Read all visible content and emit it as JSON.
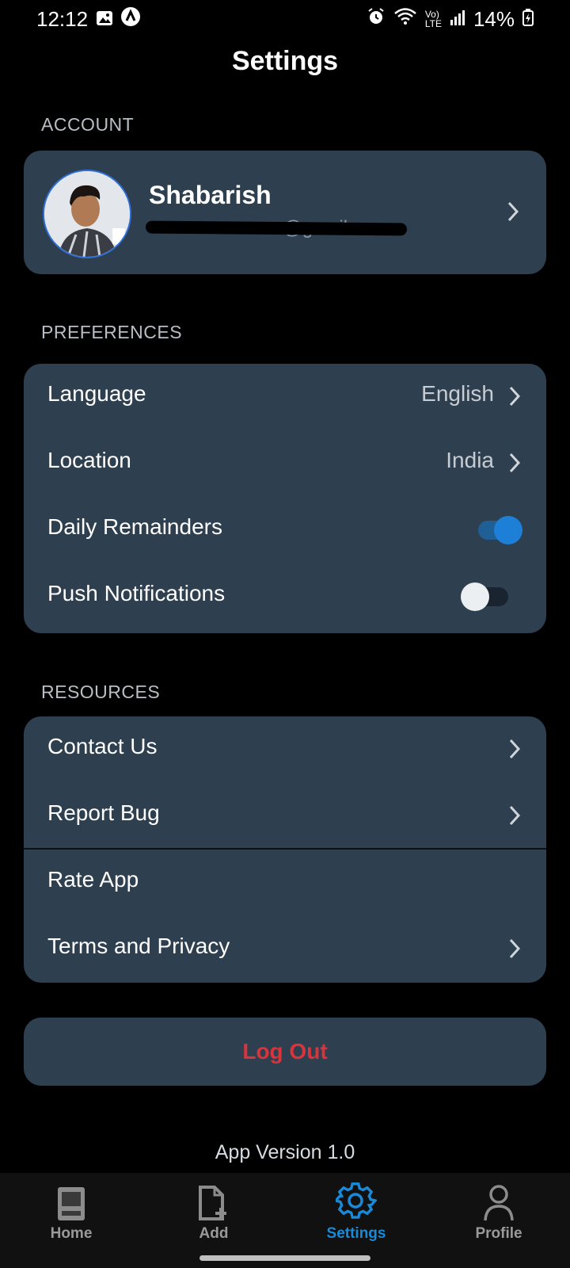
{
  "status": {
    "time": "12:12",
    "battery": "14%"
  },
  "header": {
    "title": "Settings"
  },
  "account": {
    "section_label": "ACCOUNT",
    "name": "Shabarish",
    "email_visible_part": "a@gmail.com"
  },
  "preferences": {
    "section_label": "PREFERENCES",
    "language": {
      "label": "Language",
      "value": "English"
    },
    "location": {
      "label": "Location",
      "value": "India"
    },
    "daily_reminders": {
      "label": "Daily Remainders",
      "on": true
    },
    "push_notifications": {
      "label": "Push Notifications",
      "on": false
    }
  },
  "resources": {
    "section_label": "RESOURCES",
    "items": [
      "Contact Us",
      "Report Bug",
      "Rate App",
      "Terms and Privacy"
    ]
  },
  "logout_label": "Log Out",
  "app_version": "App Version 1.0",
  "nav": {
    "items": [
      {
        "label": "Home",
        "icon": "book-icon",
        "active": false
      },
      {
        "label": "Add",
        "icon": "add-file-icon",
        "active": false
      },
      {
        "label": "Settings",
        "icon": "gear-icon",
        "active": true
      },
      {
        "label": "Profile",
        "icon": "person-icon",
        "active": false
      }
    ]
  },
  "colors": {
    "accent": "#1e88e5",
    "card": "#2e3f50",
    "logout": "#d9333b",
    "nav_active": "#1a8ad8"
  }
}
